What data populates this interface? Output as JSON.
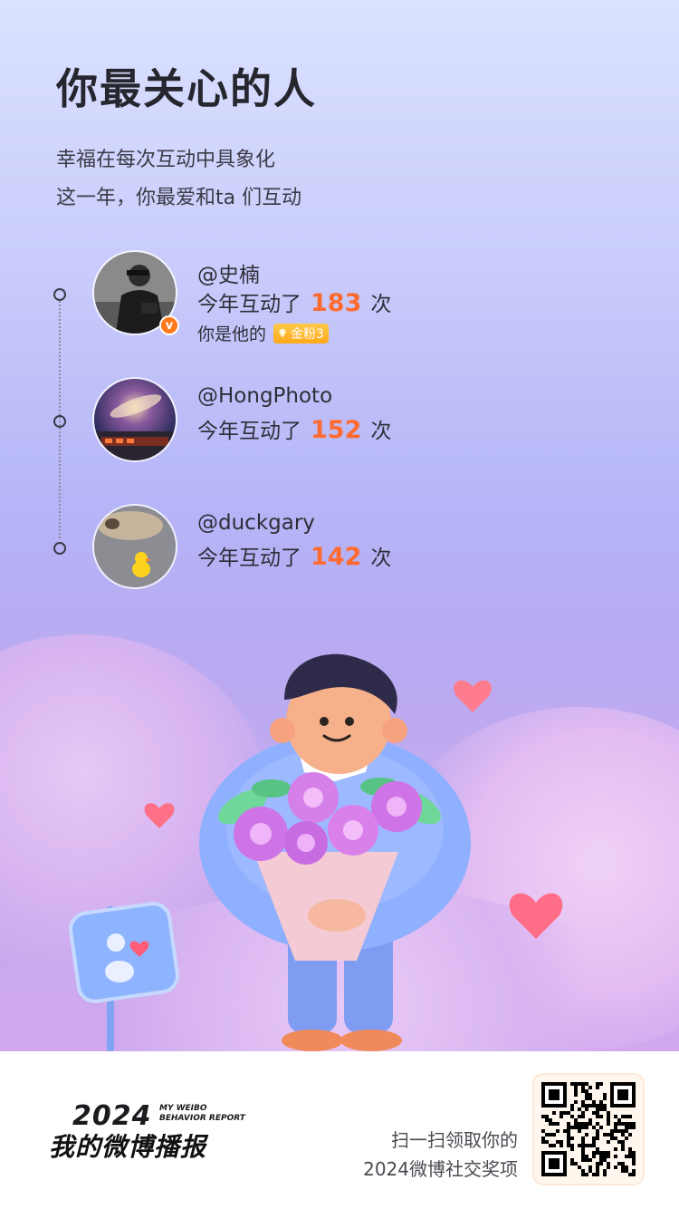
{
  "header": {
    "title": "你最关心的人",
    "subtitle_line1": "幸福在每次互动中具象化",
    "subtitle_line2": "这一年，你最爱和ta 们互动"
  },
  "people": [
    {
      "handle": "@史楠",
      "interaction_prefix": "今年互动了",
      "count": "183",
      "interaction_suffix": "次",
      "role_text": "你是他的",
      "fan_badge": "金粉3",
      "verified": true
    },
    {
      "handle": "@HongPhoto",
      "interaction_prefix": "今年互动了",
      "count": "152",
      "interaction_suffix": "次"
    },
    {
      "handle": "@duckgary",
      "interaction_prefix": "今年互动了",
      "count": "142",
      "interaction_suffix": "次"
    }
  ],
  "illustration": {
    "name": "boy-with-flower-bouquet-illustration"
  },
  "footer": {
    "logo_year": "2024",
    "logo_en_line1": "MY WEIBO",
    "logo_en_line2": "BEHAVIOR REPORT",
    "logo_cn": "我的微博播报",
    "cta_line1": "扫一扫领取你的",
    "cta_line2": "2024微博社交奖项"
  },
  "colors": {
    "accent": "#ff6a2e",
    "verified": "#ff7a1a",
    "fan_badge": "#ffb323"
  }
}
